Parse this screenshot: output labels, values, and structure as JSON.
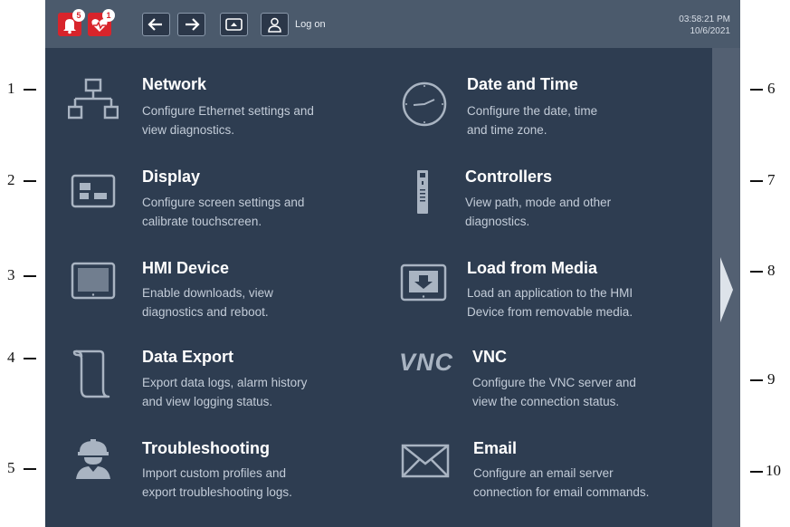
{
  "header": {
    "alarm_badge": "5",
    "diagnostics_badge": "1",
    "logon_label": "Log on",
    "time": "03:58:21 PM",
    "date": "10/6/2021"
  },
  "items": [
    {
      "title": "Network",
      "line1": "Configure Ethernet settings and",
      "line2": "view diagnostics."
    },
    {
      "title": "Display",
      "line1": "Configure screen settings and",
      "line2": "calibrate touchscreen."
    },
    {
      "title": "HMI Device",
      "line1": "Enable downloads, view",
      "line2": "diagnostics and reboot."
    },
    {
      "title": "Data Export",
      "line1": "Export data logs, alarm history",
      "line2": "and view logging status."
    },
    {
      "title": "Troubleshooting",
      "line1": "Import custom profiles and",
      "line2": "export troubleshooting logs."
    },
    {
      "title": "Date and Time",
      "line1": "Configure the date, time",
      "line2": "and time zone."
    },
    {
      "title": "Controllers",
      "line1": "View path, mode and other",
      "line2": "diagnostics."
    },
    {
      "title": "Load from Media",
      "line1": "Load an application to the HMI",
      "line2": "Device from removable media."
    },
    {
      "title": "VNC",
      "line1": "Configure the VNC server and",
      "line2": "view the connection status."
    },
    {
      "title": "Email",
      "line1": "Configure an email server",
      "line2": "connection for email commands."
    }
  ],
  "vnc_icon_text": "VNC",
  "callouts": [
    "1",
    "2",
    "3",
    "4",
    "5",
    "6",
    "7",
    "8",
    "9",
    "10"
  ],
  "colors": {
    "panel": "#2e3d51",
    "topbar": "#4b5a6c",
    "alarm_red": "#d8242b",
    "title": "#ffffff",
    "desc": "#c3ccd8"
  }
}
